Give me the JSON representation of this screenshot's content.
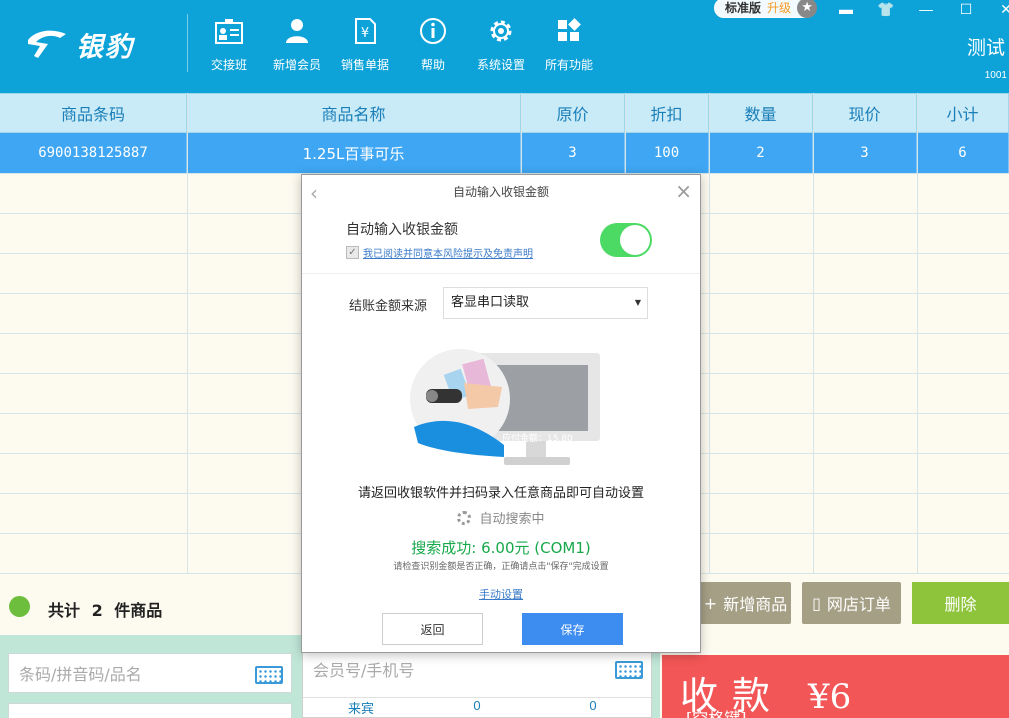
{
  "app": {
    "logo_text": "银豹",
    "edition_label": "标准版",
    "upgrade_label": "升级",
    "user_name": "测试",
    "user_id": "1001"
  },
  "toolbar": {
    "items": [
      {
        "label": "交接班",
        "icon": "shift-handover-icon"
      },
      {
        "label": "新增会员",
        "icon": "add-member-icon"
      },
      {
        "label": "销售单据",
        "icon": "sales-receipt-icon"
      },
      {
        "label": "帮助",
        "icon": "help-icon"
      },
      {
        "label": "系统设置",
        "icon": "settings-icon"
      },
      {
        "label": "所有功能",
        "icon": "all-functions-icon"
      }
    ]
  },
  "table": {
    "headers": [
      "商品条码",
      "商品名称",
      "原价",
      "折扣",
      "数量",
      "现价",
      "小计"
    ],
    "rows": [
      [
        "6900138125887",
        "1.25L百事可乐",
        "3",
        "100",
        "2",
        "3",
        "6"
      ]
    ]
  },
  "summary": {
    "total_label": "共计 2 件商品",
    "add_product": "新增商品",
    "web_order": "网店订单",
    "delete": "删除"
  },
  "inputs": {
    "barcode_placeholder": "条码/拼音码/品名",
    "member_placeholder": "会员号/手机号",
    "member_stats": [
      "来宾",
      "0",
      "0"
    ]
  },
  "payment": {
    "label": "收款",
    "shortcut": "[空格键]",
    "amount": "¥6"
  },
  "modal": {
    "title": "自动输入收银金额",
    "auto_input_label": "自动输入收银金额",
    "agreement": "我已阅读并同意本风险提示及免责声明",
    "toggle_on": true,
    "source_label": "结账金额来源",
    "source_value": "客显串口读取",
    "screen_amount": "应付金额：15.80",
    "instruction": "请返回收银软件并扫码录入任意商品即可自动设置",
    "searching": "自动搜索中",
    "success": "搜索成功: 6.00元 (COM1)",
    "hint": "请检查识别金额是否正确，正确请点击\"保存\"完成设置",
    "manual": "手动设置",
    "back": "返回",
    "save": "保存"
  },
  "colors": {
    "topbar": "#0ea3d8",
    "selected_row": "#3ea6f2",
    "toggle_on": "#4cd964",
    "save_button": "#3d8cf0",
    "pay_button": "#f25656",
    "delete_button": "#8ec43c"
  }
}
